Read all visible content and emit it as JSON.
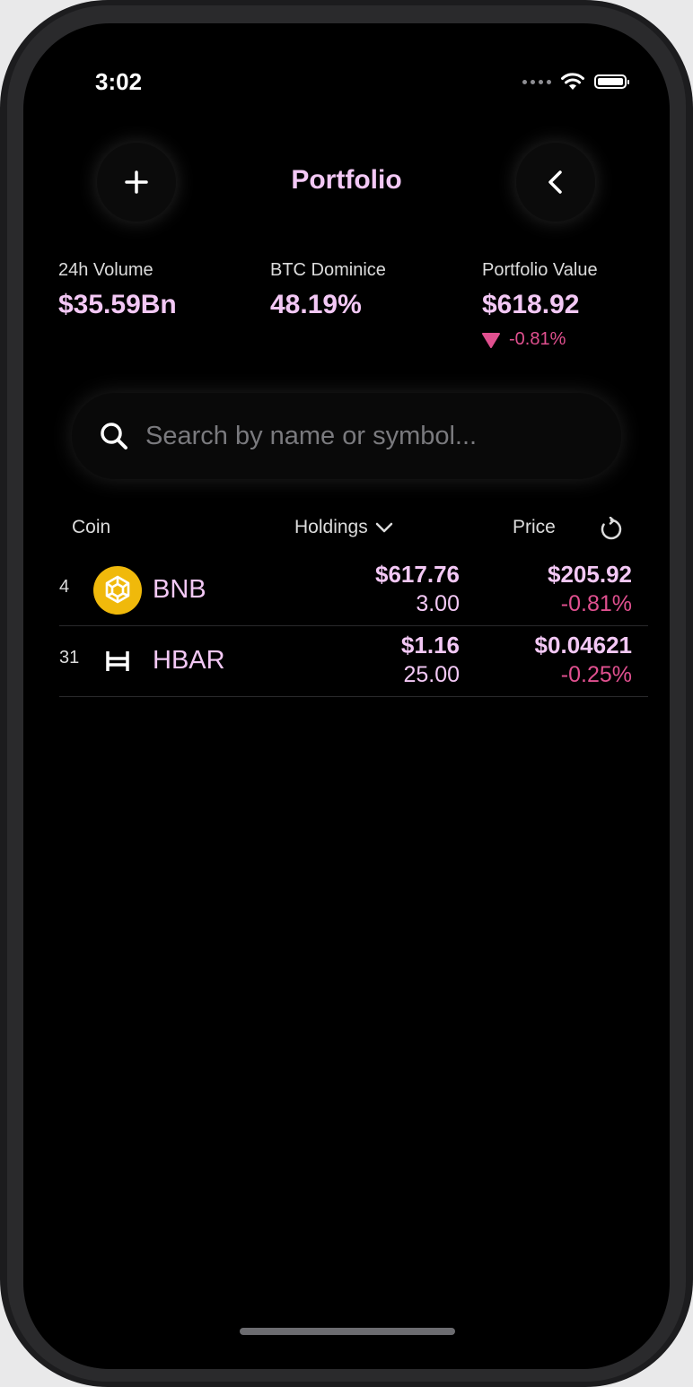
{
  "status_bar": {
    "time": "3:02"
  },
  "header": {
    "title": "Portfolio",
    "add_icon": "plus-icon",
    "back_icon": "chevron-left-icon"
  },
  "stats": [
    {
      "label": "24h Volume",
      "value": "$35.59Bn"
    },
    {
      "label": "BTC Dominice",
      "value": "48.19%"
    },
    {
      "label": "Portfolio Value",
      "value": "$618.92",
      "change": "-0.81%"
    }
  ],
  "search": {
    "placeholder": "Search by name or symbol..."
  },
  "columns": {
    "coin": "Coin",
    "holdings": "Holdings",
    "price": "Price"
  },
  "coins": [
    {
      "rank": "4",
      "symbol": "BNB",
      "holdings_value": "$617.76",
      "holdings_qty": "3.00",
      "price": "$205.92",
      "change": "-0.81%",
      "icon": "bnb-logo-icon"
    },
    {
      "rank": "31",
      "symbol": "HBAR",
      "holdings_value": "$1.16",
      "holdings_qty": "25.00",
      "price": "$0.04621",
      "change": "-0.25%",
      "icon": "hbar-logo-icon"
    }
  ],
  "colors": {
    "accent": "#f3c8f5",
    "negative": "#e0508f",
    "bnb": "#f0b90b"
  }
}
